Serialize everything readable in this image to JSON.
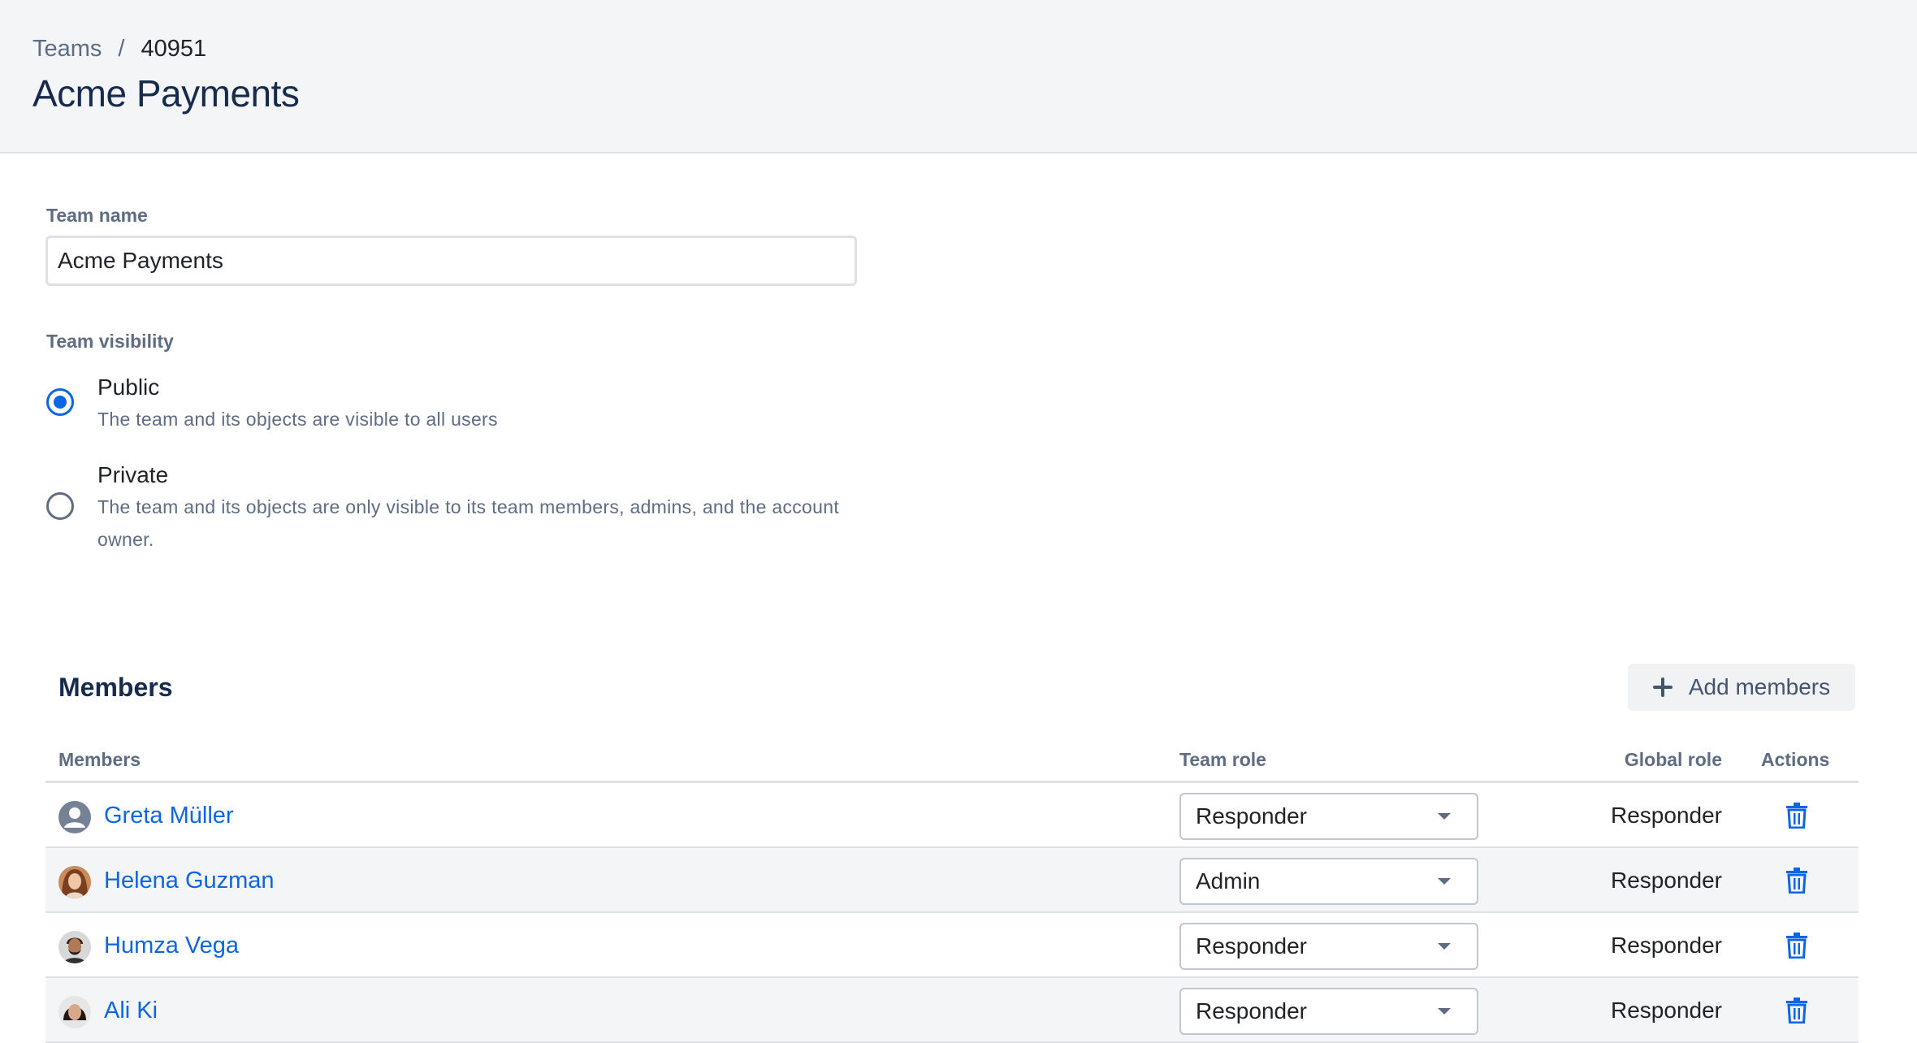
{
  "breadcrumb": {
    "parent": "Teams",
    "separator": "/",
    "current": "40951"
  },
  "page": {
    "title": "Acme Payments"
  },
  "form": {
    "team_name_label": "Team name",
    "team_name_value": "Acme Payments",
    "visibility_label": "Team visibility",
    "visibility_options": [
      {
        "title": "Public",
        "description": "The team and its objects are visible to all users",
        "selected": true
      },
      {
        "title": "Private",
        "description": "The team and its objects are only visible to its team members, admins, and the account owner.",
        "selected": false
      }
    ]
  },
  "members": {
    "section_title": "Members",
    "add_button": "Add members",
    "columns": {
      "members": "Members",
      "team_role": "Team role",
      "global_role": "Global role",
      "actions": "Actions"
    },
    "rows": [
      {
        "name": "Greta Müller",
        "team_role": "Responder",
        "global_role": "Responder",
        "avatar": "generic-user-icon"
      },
      {
        "name": "Helena Guzman",
        "team_role": "Admin",
        "global_role": "Responder",
        "avatar": "photo-avatar"
      },
      {
        "name": "Humza Vega",
        "team_role": "Responder",
        "global_role": "Responder",
        "avatar": "photo-avatar"
      },
      {
        "name": "Ali Ki",
        "team_role": "Responder",
        "global_role": "Responder",
        "avatar": "photo-avatar"
      }
    ]
  },
  "colors": {
    "accent": "#0c66e4",
    "header_bg": "#f4f5f7",
    "muted_text": "#5e6c84"
  }
}
